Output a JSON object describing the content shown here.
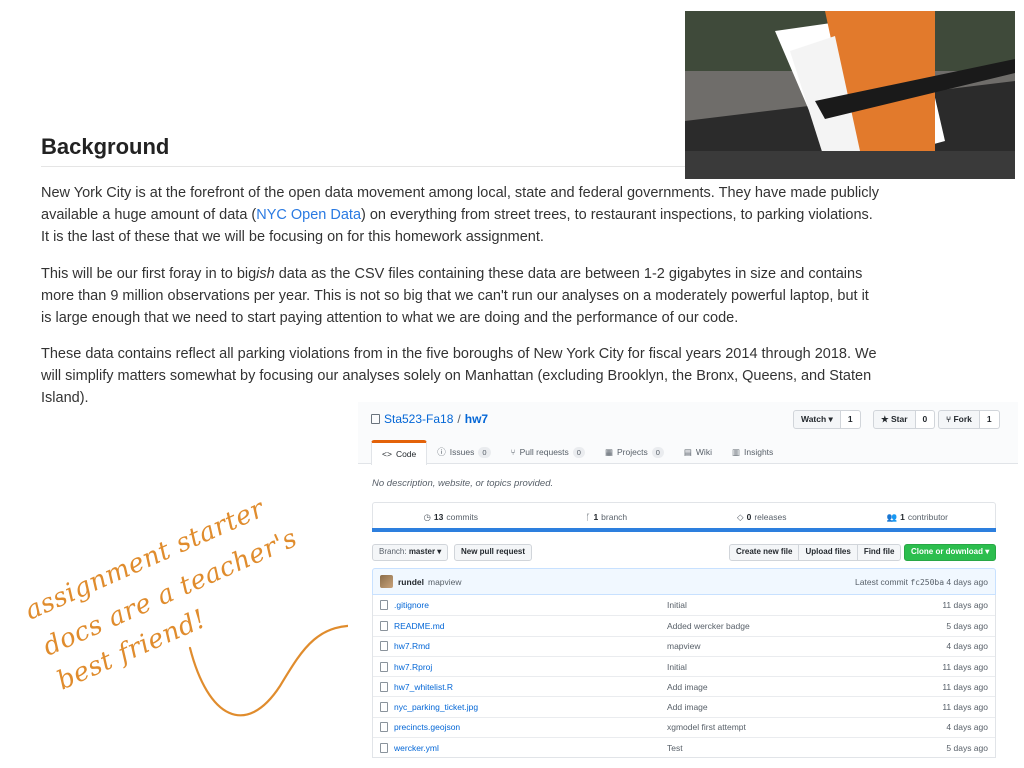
{
  "background": {
    "heading": "Background",
    "para1_before": "New York City is at the forefront of the open data movement among local, state and federal governments. They have made publicly available a huge amount of data (",
    "para1_link": "NYC Open Data",
    "para1_after": ") on everything from street trees, to restaurant inspections, to parking violations. It is the last of these that we will be focusing on for this homework assignment.",
    "para2_before": "This will be our first foray in to big",
    "para2_em": "ish",
    "para2_after": " data as the CSV files containing these data are between 1-2 gigabytes in size and contains more than 9 million observations per year. This is not so big that we can't run our analyses on a moderately powerful laptop, but it is large enough that we need to start paying attention to what we are doing and the performance of our code.",
    "para3": "These data contains reflect all parking violations from in the five boroughs of New York City for fiscal years 2014 through 2018. We will simplify matters somewhat by focusing our analyses solely on Manhattan (excluding Brooklyn, the Bronx, Queens, and Staten Island)."
  },
  "annotation": {
    "line1": "assignment starter",
    "line2": "docs are a teacher's",
    "line3": "best friend!",
    "color": "#e08c2d"
  },
  "repo": {
    "owner": "Sta523-Fa18",
    "separator": "/",
    "name": "hw7",
    "watch_label": "Watch ▾",
    "watch_count": "1",
    "star_label": "★ Star",
    "star_count": "0",
    "fork_label": "Fork",
    "fork_count": "1",
    "tabs": [
      {
        "label": "Code",
        "icon": "<>"
      },
      {
        "label": "Issues",
        "count": "0"
      },
      {
        "label": "Pull requests",
        "count": "0"
      },
      {
        "label": "Projects",
        "count": "0"
      },
      {
        "label": "Wiki"
      },
      {
        "label": "Insights"
      }
    ],
    "description": "No description, website, or topics provided.",
    "summary": {
      "commits_count": "13",
      "commits_label": "commits",
      "branch_count": "1",
      "branch_label": "branch",
      "releases_count": "0",
      "releases_label": "releases",
      "contributor_count": "1",
      "contributor_label": "contributor"
    },
    "lang_color": "#2d7fde",
    "branch_prefix": "Branch:",
    "branch_name": "master ▾",
    "new_pr": "New pull request",
    "create_file": "Create new file",
    "upload_files": "Upload files",
    "find_file": "Find file",
    "clone": "Clone or download ▾",
    "clone_color": "#2cbe4e",
    "commit": {
      "author": "rundel",
      "message": "mapview",
      "latest_prefix": "Latest commit",
      "sha": "fc250ba",
      "age": "4 days ago"
    },
    "files": [
      {
        "name": ".gitignore",
        "message": "Initial",
        "age": "11 days ago"
      },
      {
        "name": "README.md",
        "message": "Added wercker badge",
        "age": "5 days ago"
      },
      {
        "name": "hw7.Rmd",
        "message": "mapview",
        "age": "4 days ago"
      },
      {
        "name": "hw7.Rproj",
        "message": "Initial",
        "age": "11 days ago"
      },
      {
        "name": "hw7_whitelist.R",
        "message": "Add image",
        "age": "11 days ago"
      },
      {
        "name": "nyc_parking_ticket.jpg",
        "message": "Add image",
        "age": "11 days ago"
      },
      {
        "name": "precincts.geojson",
        "message": "xgmodel first attempt",
        "age": "4 days ago"
      },
      {
        "name": "wercker.yml",
        "message": "Test",
        "age": "5 days ago"
      }
    ]
  }
}
